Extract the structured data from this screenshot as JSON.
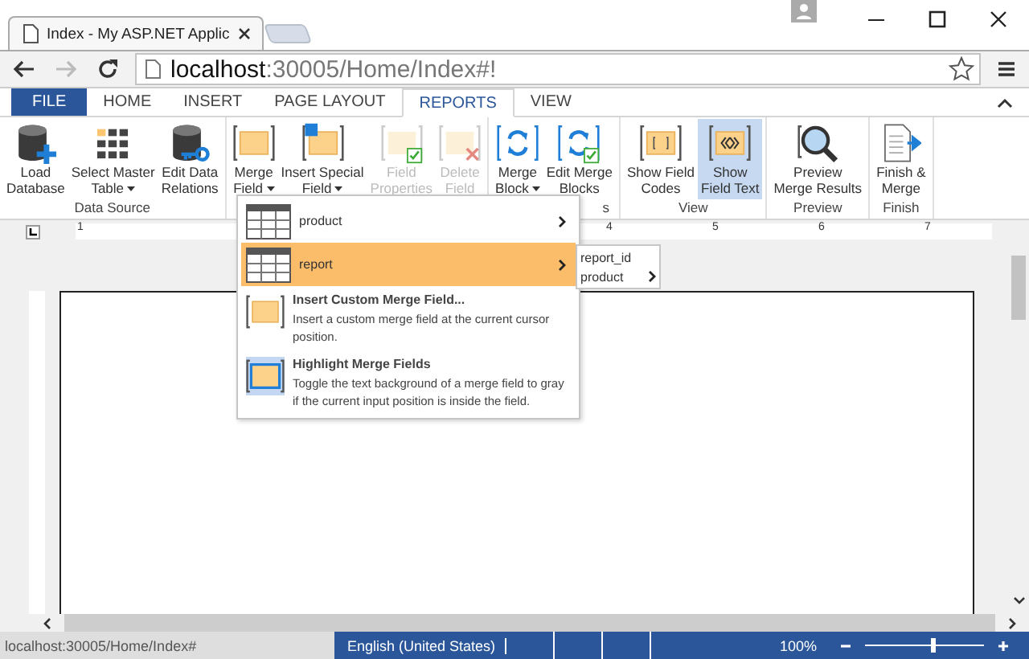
{
  "browser": {
    "tab_title": "Index - My ASP.NET Applic",
    "url_host": "localhost",
    "url_path": ":30005/Home/Index#!"
  },
  "ribbon_tabs": [
    {
      "label": "FILE",
      "kind": "file",
      "selected": false
    },
    {
      "label": "HOME",
      "kind": "tab",
      "selected": false
    },
    {
      "label": "INSERT",
      "kind": "tab",
      "selected": false
    },
    {
      "label": "PAGE LAYOUT",
      "kind": "tab",
      "selected": false
    },
    {
      "label": "REPORTS",
      "kind": "tab",
      "selected": true
    },
    {
      "label": "VIEW",
      "kind": "tab",
      "selected": false
    }
  ],
  "groups": [
    {
      "label": "Data Source",
      "buttons": [
        {
          "lines": [
            "Load",
            "Database"
          ],
          "kind": "database",
          "dropdown": false,
          "disabled": false,
          "selected": false
        },
        {
          "lines": [
            "Select Master",
            "Table"
          ],
          "kind": "grid",
          "dropdown": true,
          "disabled": false,
          "selected": false
        },
        {
          "lines": [
            "Edit Data",
            "Relations"
          ],
          "kind": "relations",
          "dropdown": false,
          "disabled": false,
          "selected": false
        }
      ]
    },
    {
      "buttons": [
        {
          "lines": [
            "Merge",
            "Field"
          ],
          "kind": "field",
          "dropdown": true,
          "disabled": false,
          "selected": false
        },
        {
          "lines": [
            "Insert Special",
            "Field"
          ],
          "kind": "special",
          "dropdown": true,
          "disabled": false,
          "selected": false
        },
        {
          "lines": [
            "Field",
            "Properties"
          ],
          "kind": "properties",
          "dropdown": false,
          "disabled": true,
          "selected": false
        },
        {
          "lines": [
            "Delete",
            "Field"
          ],
          "kind": "delete",
          "dropdown": false,
          "disabled": true,
          "selected": false
        }
      ]
    },
    {
      "label": "s",
      "buttons": [
        {
          "lines": [
            "Merge",
            "Block"
          ],
          "kind": "block",
          "dropdown": true,
          "disabled": false,
          "selected": false
        },
        {
          "lines": [
            "Edit Merge",
            "Blocks"
          ],
          "kind": "editblock",
          "dropdown": false,
          "disabled": false,
          "selected": false
        }
      ]
    },
    {
      "label": "View",
      "buttons": [
        {
          "lines": [
            "Show Field",
            "Codes"
          ],
          "kind": "codes",
          "dropdown": false,
          "disabled": false,
          "selected": false
        },
        {
          "lines": [
            "Show",
            "Field Text"
          ],
          "kind": "text",
          "dropdown": false,
          "disabled": false,
          "selected": true
        }
      ]
    },
    {
      "label": "Preview",
      "buttons": [
        {
          "lines": [
            "Preview",
            "Merge Results"
          ],
          "kind": "preview",
          "dropdown": false,
          "disabled": false,
          "selected": false
        }
      ]
    },
    {
      "label": "Finish",
      "buttons": [
        {
          "lines": [
            "Finish &",
            "Merge"
          ],
          "kind": "finish",
          "dropdown": false,
          "disabled": false,
          "selected": false
        }
      ]
    }
  ],
  "ruler_numbers": [
    "1",
    "4",
    "5",
    "6",
    "7"
  ],
  "merge_menu": {
    "items": [
      {
        "kind": "table",
        "label": "product",
        "has_submenu": true,
        "selected": false
      },
      {
        "kind": "table",
        "label": "report",
        "has_submenu": true,
        "selected": true
      },
      {
        "kind": "custom",
        "title": "Insert Custom Merge Field...",
        "description": "Insert a custom merge field at the current cursor position.",
        "selected": false
      },
      {
        "kind": "highlight",
        "title": "Highlight Merge Fields",
        "description": "Toggle the text background of a merge field to gray if the current input position is inside the field.",
        "selected": false
      }
    ]
  },
  "submenu": {
    "items": [
      {
        "label": "report_id",
        "has_submenu": false
      },
      {
        "label": "product",
        "has_submenu": true
      }
    ]
  },
  "status_bar": {
    "url": "localhost:30005/Home/Index#",
    "language": "English (United States)",
    "zoom": "100%",
    "zoom_slider": {
      "level": 0.57
    }
  }
}
